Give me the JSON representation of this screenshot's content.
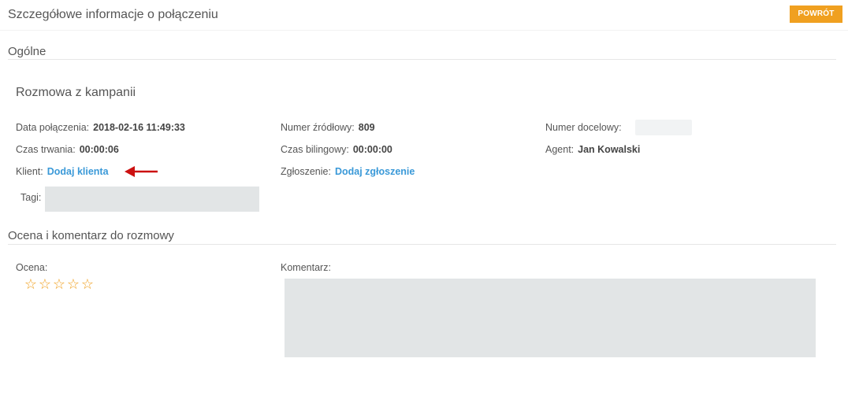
{
  "header": {
    "title": "Szczegółowe informacje o połączeniu",
    "back_label": "POWRÓT"
  },
  "sections": {
    "general": "Ogólne",
    "rating_comment": "Ocena i komentarz do rozmowy"
  },
  "call": {
    "subtitle": "Rozmowa z kampanii",
    "date_label": "Data połączenia:",
    "date_value": "2018-02-16 11:49:33",
    "duration_label": "Czas trwania:",
    "duration_value": "00:00:06",
    "client_label": "Klient:",
    "client_link": "Dodaj klienta",
    "source_label": "Numer źródłowy:",
    "source_value": "809",
    "billing_label": "Czas bilingowy:",
    "billing_value": "00:00:00",
    "ticket_label": "Zgłoszenie:",
    "ticket_link": "Dodaj zgłoszenie",
    "target_label": "Numer docelowy:",
    "agent_label": "Agent:",
    "agent_value": "Jan Kowalski",
    "tags_label": "Tagi:"
  },
  "rating": {
    "label": "Ocena:",
    "stars_glyph": "☆",
    "value": 0,
    "max": 5
  },
  "comment": {
    "label": "Komentarz:",
    "value": ""
  },
  "colors": {
    "accent": "#f0a020",
    "link": "#3a99d8",
    "arrow": "#cc1111",
    "input_bg": "#e2e5e6"
  },
  "icons": {
    "arrow": "left-arrow-icon",
    "star": "star-outline-icon"
  }
}
